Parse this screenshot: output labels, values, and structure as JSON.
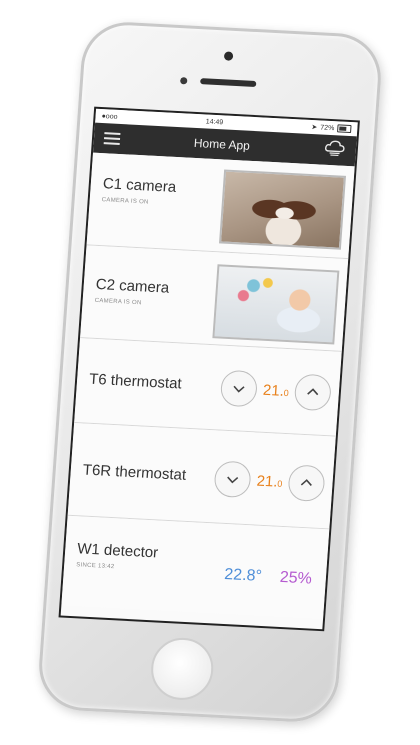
{
  "status_bar": {
    "carrier": "●ooo",
    "time": "14:49",
    "battery": "72%"
  },
  "nav": {
    "title": "Home App"
  },
  "devices": [
    {
      "name": "C1 camera",
      "status": "CAMERA IS ON",
      "image": "dog-photo"
    },
    {
      "name": "C2 camera",
      "status": "CAMERA IS ON",
      "image": "baby-crib-photo"
    },
    {
      "name": "T6 thermostat",
      "temperature": "21.",
      "temperature_decimal": "0"
    },
    {
      "name": "T6R thermostat",
      "temperature": "21.",
      "temperature_decimal": "0"
    },
    {
      "name": "W1 detector",
      "status": "SINCE 13:42",
      "temperature": "22.8°",
      "humidity": "25%"
    }
  ],
  "colors": {
    "nav_background": "#2e2e2e",
    "thermostat_temp": "#e8811c",
    "detector_temp": "#4e8ed8",
    "detector_humidity": "#b55bd0"
  },
  "icons": {
    "menu": "hamburger-menu-icon",
    "weather": "cloud-icon",
    "decrease": "chevron-down-icon",
    "increase": "chevron-up-icon"
  }
}
